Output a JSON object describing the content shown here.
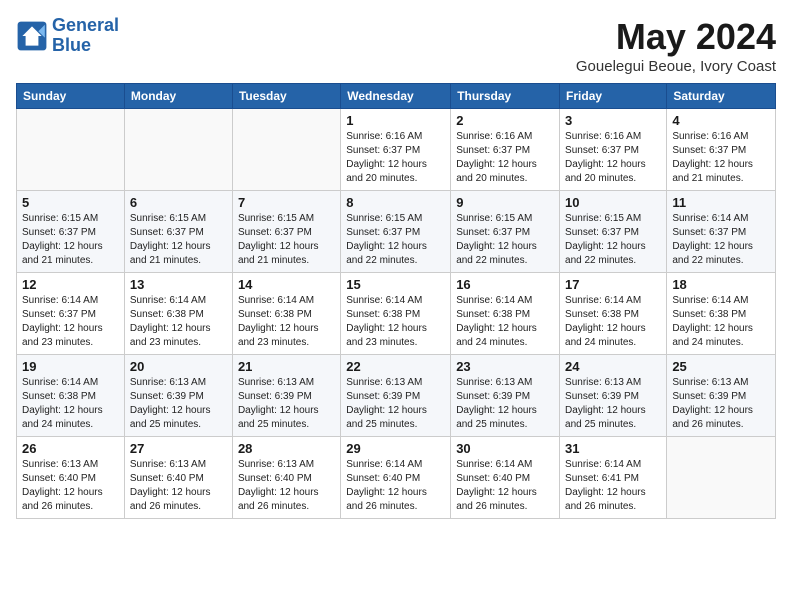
{
  "header": {
    "logo_general": "General",
    "logo_blue": "Blue",
    "month": "May 2024",
    "location": "Gouelegui Beoue, Ivory Coast"
  },
  "weekdays": [
    "Sunday",
    "Monday",
    "Tuesday",
    "Wednesday",
    "Thursday",
    "Friday",
    "Saturday"
  ],
  "weeks": [
    [
      {
        "day": "",
        "info": ""
      },
      {
        "day": "",
        "info": ""
      },
      {
        "day": "",
        "info": ""
      },
      {
        "day": "1",
        "info": "Sunrise: 6:16 AM\nSunset: 6:37 PM\nDaylight: 12 hours and 20 minutes."
      },
      {
        "day": "2",
        "info": "Sunrise: 6:16 AM\nSunset: 6:37 PM\nDaylight: 12 hours and 20 minutes."
      },
      {
        "day": "3",
        "info": "Sunrise: 6:16 AM\nSunset: 6:37 PM\nDaylight: 12 hours and 20 minutes."
      },
      {
        "day": "4",
        "info": "Sunrise: 6:16 AM\nSunset: 6:37 PM\nDaylight: 12 hours and 21 minutes."
      }
    ],
    [
      {
        "day": "5",
        "info": "Sunrise: 6:15 AM\nSunset: 6:37 PM\nDaylight: 12 hours and 21 minutes."
      },
      {
        "day": "6",
        "info": "Sunrise: 6:15 AM\nSunset: 6:37 PM\nDaylight: 12 hours and 21 minutes."
      },
      {
        "day": "7",
        "info": "Sunrise: 6:15 AM\nSunset: 6:37 PM\nDaylight: 12 hours and 21 minutes."
      },
      {
        "day": "8",
        "info": "Sunrise: 6:15 AM\nSunset: 6:37 PM\nDaylight: 12 hours and 22 minutes."
      },
      {
        "day": "9",
        "info": "Sunrise: 6:15 AM\nSunset: 6:37 PM\nDaylight: 12 hours and 22 minutes."
      },
      {
        "day": "10",
        "info": "Sunrise: 6:15 AM\nSunset: 6:37 PM\nDaylight: 12 hours and 22 minutes."
      },
      {
        "day": "11",
        "info": "Sunrise: 6:14 AM\nSunset: 6:37 PM\nDaylight: 12 hours and 22 minutes."
      }
    ],
    [
      {
        "day": "12",
        "info": "Sunrise: 6:14 AM\nSunset: 6:37 PM\nDaylight: 12 hours and 23 minutes."
      },
      {
        "day": "13",
        "info": "Sunrise: 6:14 AM\nSunset: 6:38 PM\nDaylight: 12 hours and 23 minutes."
      },
      {
        "day": "14",
        "info": "Sunrise: 6:14 AM\nSunset: 6:38 PM\nDaylight: 12 hours and 23 minutes."
      },
      {
        "day": "15",
        "info": "Sunrise: 6:14 AM\nSunset: 6:38 PM\nDaylight: 12 hours and 23 minutes."
      },
      {
        "day": "16",
        "info": "Sunrise: 6:14 AM\nSunset: 6:38 PM\nDaylight: 12 hours and 24 minutes."
      },
      {
        "day": "17",
        "info": "Sunrise: 6:14 AM\nSunset: 6:38 PM\nDaylight: 12 hours and 24 minutes."
      },
      {
        "day": "18",
        "info": "Sunrise: 6:14 AM\nSunset: 6:38 PM\nDaylight: 12 hours and 24 minutes."
      }
    ],
    [
      {
        "day": "19",
        "info": "Sunrise: 6:14 AM\nSunset: 6:38 PM\nDaylight: 12 hours and 24 minutes."
      },
      {
        "day": "20",
        "info": "Sunrise: 6:13 AM\nSunset: 6:39 PM\nDaylight: 12 hours and 25 minutes."
      },
      {
        "day": "21",
        "info": "Sunrise: 6:13 AM\nSunset: 6:39 PM\nDaylight: 12 hours and 25 minutes."
      },
      {
        "day": "22",
        "info": "Sunrise: 6:13 AM\nSunset: 6:39 PM\nDaylight: 12 hours and 25 minutes."
      },
      {
        "day": "23",
        "info": "Sunrise: 6:13 AM\nSunset: 6:39 PM\nDaylight: 12 hours and 25 minutes."
      },
      {
        "day": "24",
        "info": "Sunrise: 6:13 AM\nSunset: 6:39 PM\nDaylight: 12 hours and 25 minutes."
      },
      {
        "day": "25",
        "info": "Sunrise: 6:13 AM\nSunset: 6:39 PM\nDaylight: 12 hours and 26 minutes."
      }
    ],
    [
      {
        "day": "26",
        "info": "Sunrise: 6:13 AM\nSunset: 6:40 PM\nDaylight: 12 hours and 26 minutes."
      },
      {
        "day": "27",
        "info": "Sunrise: 6:13 AM\nSunset: 6:40 PM\nDaylight: 12 hours and 26 minutes."
      },
      {
        "day": "28",
        "info": "Sunrise: 6:13 AM\nSunset: 6:40 PM\nDaylight: 12 hours and 26 minutes."
      },
      {
        "day": "29",
        "info": "Sunrise: 6:14 AM\nSunset: 6:40 PM\nDaylight: 12 hours and 26 minutes."
      },
      {
        "day": "30",
        "info": "Sunrise: 6:14 AM\nSunset: 6:40 PM\nDaylight: 12 hours and 26 minutes."
      },
      {
        "day": "31",
        "info": "Sunrise: 6:14 AM\nSunset: 6:41 PM\nDaylight: 12 hours and 26 minutes."
      },
      {
        "day": "",
        "info": ""
      }
    ]
  ]
}
